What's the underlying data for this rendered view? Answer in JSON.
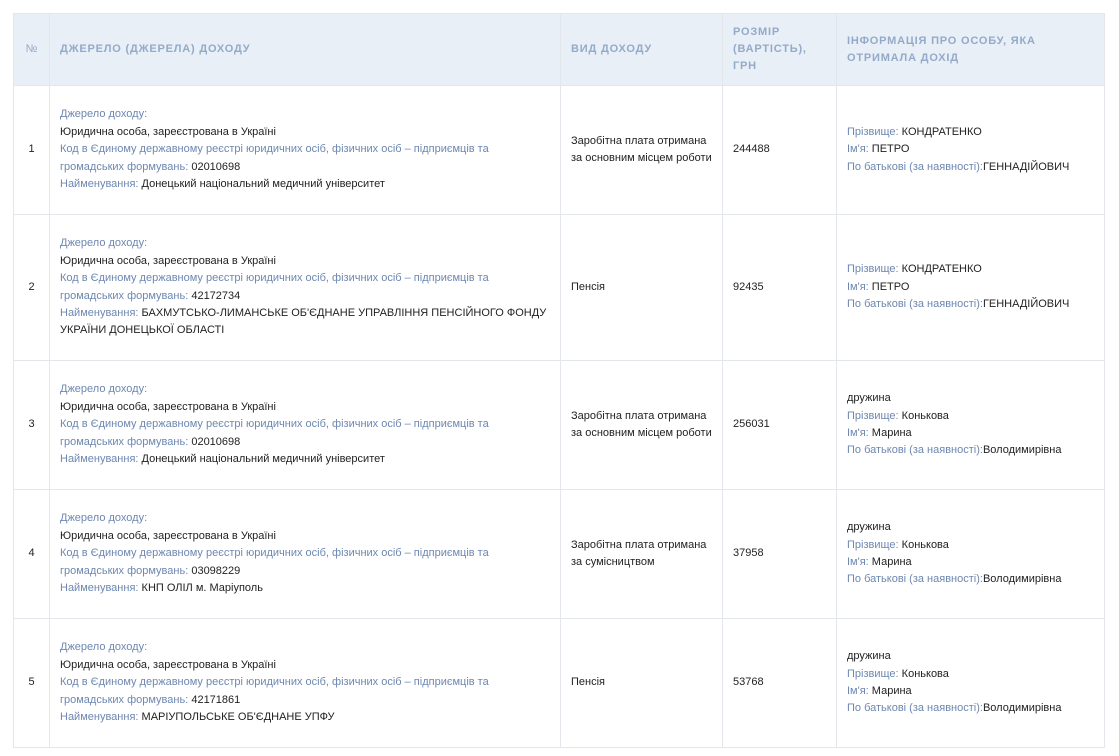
{
  "headers": {
    "num": "№",
    "source": "ДЖЕРЕЛО (ДЖЕРЕЛА) ДОХОДУ",
    "type": "ВИД ДОХОДУ",
    "amount": "РОЗМІР (ВАРТІСТЬ), ГРН",
    "person": "ІНФОРМАЦІЯ ПРО ОСОБУ, ЯКА ОТРИМАЛА ДОХІД"
  },
  "labels": {
    "source_title": "Джерело доходу:",
    "code": "Код в Єдиному державному реєстрі юридичних осіб, фізичних осіб – підприємців та громадських формувань:",
    "name": "Найменування:",
    "surname": "Прізвище:",
    "firstname": "Ім'я:",
    "patronymic": "По батькові (за наявності):"
  },
  "rows": [
    {
      "num": "1",
      "entity": "Юридична особа, зареєстрована в Україні",
      "code": "02010698",
      "name": "Донецький національний медичний університет",
      "type": "Заробітна плата отримана за основним місцем роботи",
      "amount": "244488",
      "relation": "",
      "surname": "КОНДРАТЕНКО",
      "firstname": "ПЕТРО",
      "patronymic": "ГЕННАДІЙОВИЧ"
    },
    {
      "num": "2",
      "entity": "Юридична особа, зареєстрована в Україні",
      "code": "42172734",
      "name": "БАХМУТСЬКО-ЛИМАНСЬКЕ ОБ'ЄДНАНЕ УПРАВЛІННЯ ПЕНСІЙНОГО ФОНДУ УКРАЇНИ ДОНЕЦЬКОЇ ОБЛАСТІ",
      "type": "Пенсія",
      "amount": "92435",
      "relation": "",
      "surname": "КОНДРАТЕНКО",
      "firstname": "ПЕТРО",
      "patronymic": "ГЕННАДІЙОВИЧ"
    },
    {
      "num": "3",
      "entity": "Юридична особа, зареєстрована в Україні",
      "code": "02010698",
      "name": "Донецький національний медичний університет",
      "type": "Заробітна плата отримана за основним місцем роботи",
      "amount": "256031",
      "relation": "дружина",
      "surname": "Конькова",
      "firstname": "Марина",
      "patronymic": "Володимирівна"
    },
    {
      "num": "4",
      "entity": "Юридична особа, зареєстрована в Україні",
      "code": "03098229",
      "name": "КНП ОЛІЛ м. Маріуполь",
      "type": "Заробітна плата отримана за сумісництвом",
      "amount": "37958",
      "relation": "дружина",
      "surname": "Конькова",
      "firstname": "Марина",
      "patronymic": "Володимирівна"
    },
    {
      "num": "5",
      "entity": "Юридична особа, зареєстрована в Україні",
      "code": "42171861",
      "name": "МАРІУПОЛЬСЬКЕ ОБ'ЄДНАНЕ УПФУ",
      "type": "Пенсія",
      "amount": "53768",
      "relation": "дружина",
      "surname": "Конькова",
      "firstname": "Марина",
      "patronymic": "Володимирівна"
    }
  ]
}
